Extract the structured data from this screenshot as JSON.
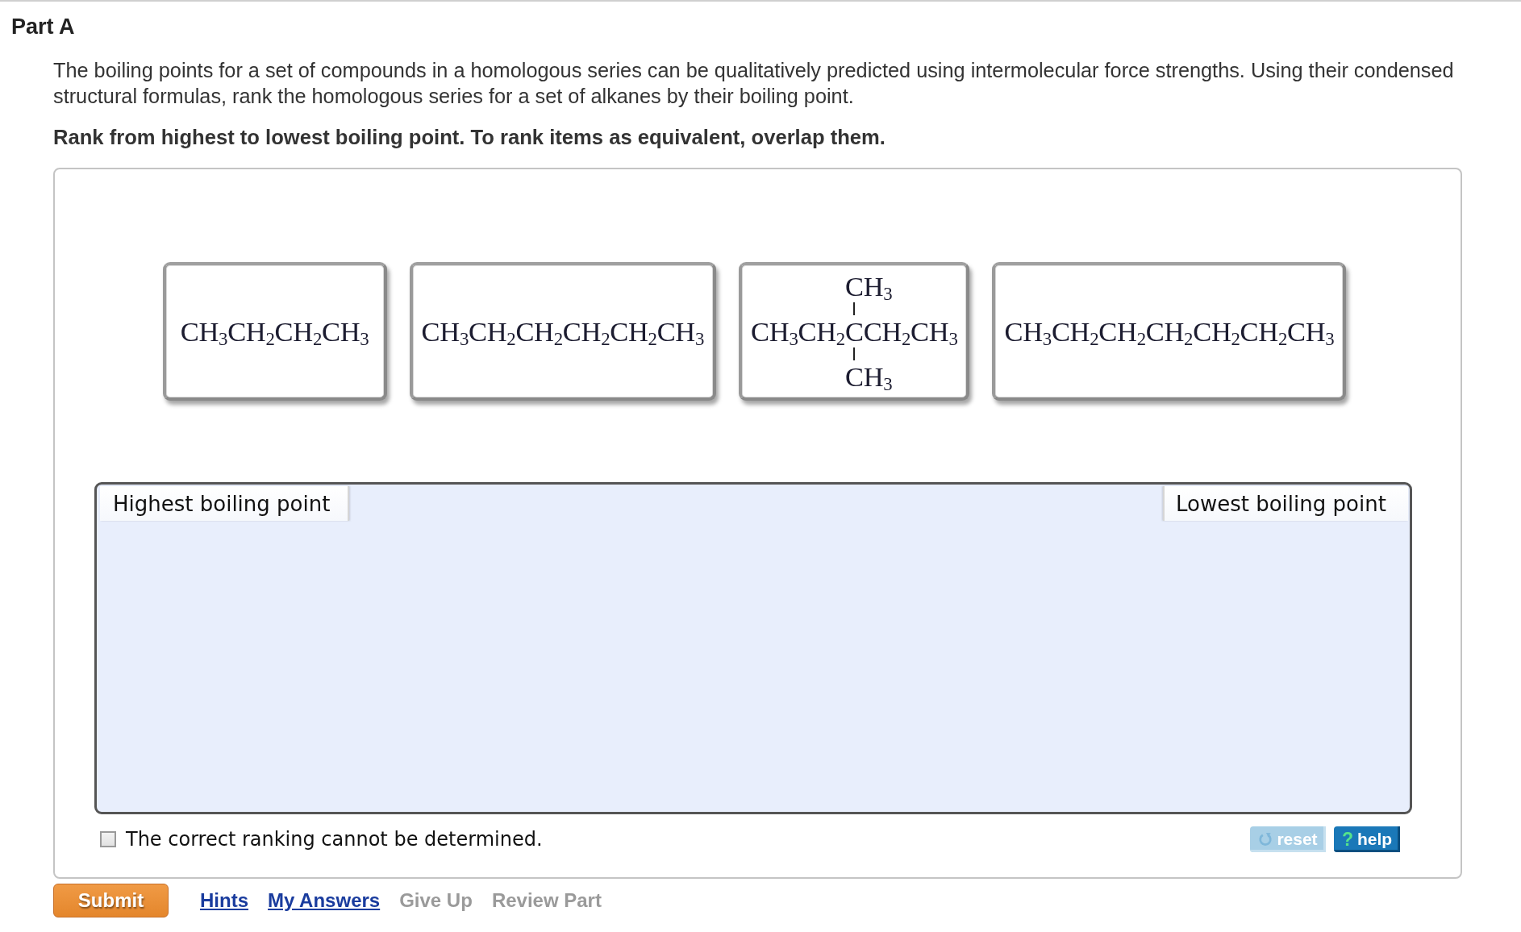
{
  "part": {
    "title": "Part A"
  },
  "question": {
    "text": "The boiling points for a set of compounds in a homologous series can be qualitatively predicted using intermolecular force strengths. Using their condensed structural formulas, rank the homologous series for a set of alkanes by their boiling point.",
    "instruction": "Rank from highest to lowest boiling point. To rank items as equivalent, overlap them."
  },
  "tiles": [
    {
      "kind": "linear",
      "formula": "CH$_{3}$CH$_{2}$CH$_{2}$CH$_{3}$"
    },
    {
      "kind": "linear",
      "formula": "CH$_{3}$CH$_{2}$CH$_{2}$CH$_{2}$CH$_{2}$CH$_{3}$"
    },
    {
      "kind": "branched",
      "top": "CH$_{3}$",
      "chain_left": "CH$_{3}$CH$_{2}$",
      "branch_atom": "C",
      "chain_right": "CH$_{2}$CH$_{3}$",
      "bottom": "CH$_{3}$"
    },
    {
      "kind": "linear",
      "formula": "CH$_{3}$CH$_{2}$CH$_{2}$CH$_{2}$CH$_{2}$CH$_{2}$CH$_{3}$"
    }
  ],
  "ranking_area": {
    "start_label": "Highest boiling point",
    "end_label": "Lowest boiling point"
  },
  "cannot_determine": {
    "label": "The correct ranking cannot be determined.",
    "checked": false
  },
  "tool_buttons": [
    {
      "kind": "reset",
      "label": "reset",
      "disabled": true
    },
    {
      "kind": "help",
      "label": "help",
      "icon": "?",
      "disabled": false
    }
  ],
  "submit_button": {
    "label": "Submit"
  },
  "links": [
    {
      "label": "Hints",
      "disabled": false
    },
    {
      "label": "My Answers",
      "disabled": false
    },
    {
      "label": "Give Up",
      "disabled": true
    },
    {
      "label": "Review Part",
      "disabled": true
    }
  ]
}
